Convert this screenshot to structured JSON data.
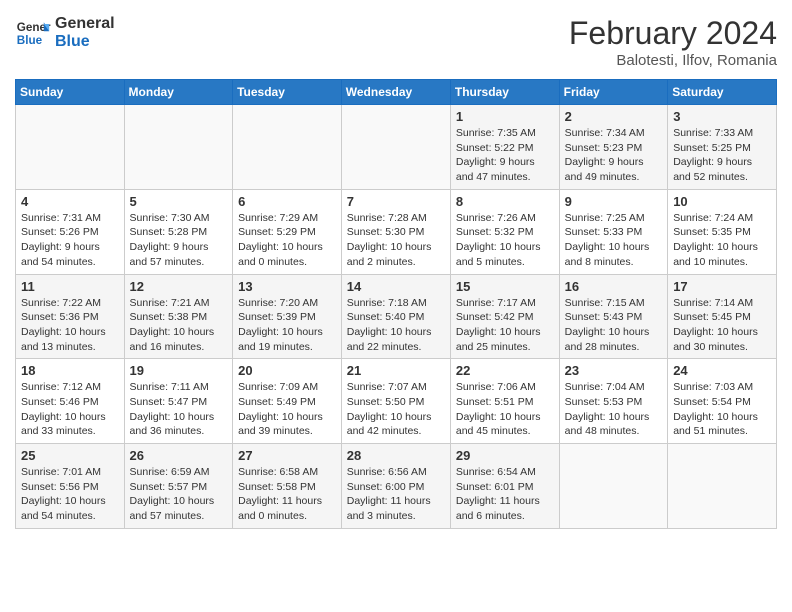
{
  "logo": {
    "line1": "General",
    "line2": "Blue"
  },
  "title": "February 2024",
  "subtitle": "Balotesti, Ilfov, Romania",
  "weekdays": [
    "Sunday",
    "Monday",
    "Tuesday",
    "Wednesday",
    "Thursday",
    "Friday",
    "Saturday"
  ],
  "weeks": [
    [
      {
        "day": "",
        "info": ""
      },
      {
        "day": "",
        "info": ""
      },
      {
        "day": "",
        "info": ""
      },
      {
        "day": "",
        "info": ""
      },
      {
        "day": "1",
        "info": "Sunrise: 7:35 AM\nSunset: 5:22 PM\nDaylight: 9 hours\nand 47 minutes."
      },
      {
        "day": "2",
        "info": "Sunrise: 7:34 AM\nSunset: 5:23 PM\nDaylight: 9 hours\nand 49 minutes."
      },
      {
        "day": "3",
        "info": "Sunrise: 7:33 AM\nSunset: 5:25 PM\nDaylight: 9 hours\nand 52 minutes."
      }
    ],
    [
      {
        "day": "4",
        "info": "Sunrise: 7:31 AM\nSunset: 5:26 PM\nDaylight: 9 hours\nand 54 minutes."
      },
      {
        "day": "5",
        "info": "Sunrise: 7:30 AM\nSunset: 5:28 PM\nDaylight: 9 hours\nand 57 minutes."
      },
      {
        "day": "6",
        "info": "Sunrise: 7:29 AM\nSunset: 5:29 PM\nDaylight: 10 hours\nand 0 minutes."
      },
      {
        "day": "7",
        "info": "Sunrise: 7:28 AM\nSunset: 5:30 PM\nDaylight: 10 hours\nand 2 minutes."
      },
      {
        "day": "8",
        "info": "Sunrise: 7:26 AM\nSunset: 5:32 PM\nDaylight: 10 hours\nand 5 minutes."
      },
      {
        "day": "9",
        "info": "Sunrise: 7:25 AM\nSunset: 5:33 PM\nDaylight: 10 hours\nand 8 minutes."
      },
      {
        "day": "10",
        "info": "Sunrise: 7:24 AM\nSunset: 5:35 PM\nDaylight: 10 hours\nand 10 minutes."
      }
    ],
    [
      {
        "day": "11",
        "info": "Sunrise: 7:22 AM\nSunset: 5:36 PM\nDaylight: 10 hours\nand 13 minutes."
      },
      {
        "day": "12",
        "info": "Sunrise: 7:21 AM\nSunset: 5:38 PM\nDaylight: 10 hours\nand 16 minutes."
      },
      {
        "day": "13",
        "info": "Sunrise: 7:20 AM\nSunset: 5:39 PM\nDaylight: 10 hours\nand 19 minutes."
      },
      {
        "day": "14",
        "info": "Sunrise: 7:18 AM\nSunset: 5:40 PM\nDaylight: 10 hours\nand 22 minutes."
      },
      {
        "day": "15",
        "info": "Sunrise: 7:17 AM\nSunset: 5:42 PM\nDaylight: 10 hours\nand 25 minutes."
      },
      {
        "day": "16",
        "info": "Sunrise: 7:15 AM\nSunset: 5:43 PM\nDaylight: 10 hours\nand 28 minutes."
      },
      {
        "day": "17",
        "info": "Sunrise: 7:14 AM\nSunset: 5:45 PM\nDaylight: 10 hours\nand 30 minutes."
      }
    ],
    [
      {
        "day": "18",
        "info": "Sunrise: 7:12 AM\nSunset: 5:46 PM\nDaylight: 10 hours\nand 33 minutes."
      },
      {
        "day": "19",
        "info": "Sunrise: 7:11 AM\nSunset: 5:47 PM\nDaylight: 10 hours\nand 36 minutes."
      },
      {
        "day": "20",
        "info": "Sunrise: 7:09 AM\nSunset: 5:49 PM\nDaylight: 10 hours\nand 39 minutes."
      },
      {
        "day": "21",
        "info": "Sunrise: 7:07 AM\nSunset: 5:50 PM\nDaylight: 10 hours\nand 42 minutes."
      },
      {
        "day": "22",
        "info": "Sunrise: 7:06 AM\nSunset: 5:51 PM\nDaylight: 10 hours\nand 45 minutes."
      },
      {
        "day": "23",
        "info": "Sunrise: 7:04 AM\nSunset: 5:53 PM\nDaylight: 10 hours\nand 48 minutes."
      },
      {
        "day": "24",
        "info": "Sunrise: 7:03 AM\nSunset: 5:54 PM\nDaylight: 10 hours\nand 51 minutes."
      }
    ],
    [
      {
        "day": "25",
        "info": "Sunrise: 7:01 AM\nSunset: 5:56 PM\nDaylight: 10 hours\nand 54 minutes."
      },
      {
        "day": "26",
        "info": "Sunrise: 6:59 AM\nSunset: 5:57 PM\nDaylight: 10 hours\nand 57 minutes."
      },
      {
        "day": "27",
        "info": "Sunrise: 6:58 AM\nSunset: 5:58 PM\nDaylight: 11 hours\nand 0 minutes."
      },
      {
        "day": "28",
        "info": "Sunrise: 6:56 AM\nSunset: 6:00 PM\nDaylight: 11 hours\nand 3 minutes."
      },
      {
        "day": "29",
        "info": "Sunrise: 6:54 AM\nSunset: 6:01 PM\nDaylight: 11 hours\nand 6 minutes."
      },
      {
        "day": "",
        "info": ""
      },
      {
        "day": "",
        "info": ""
      }
    ]
  ]
}
